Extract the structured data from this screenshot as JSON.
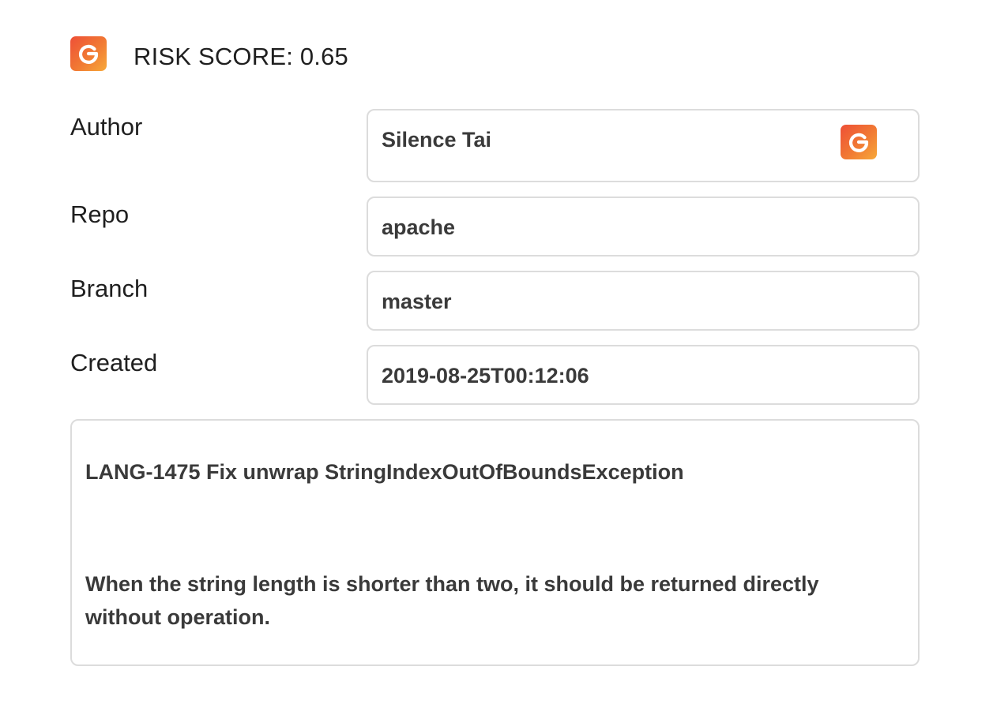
{
  "header": {
    "logo_icon": "g-logo-icon",
    "risk_score_text": "RISK SCORE: 0.65"
  },
  "fields": {
    "author": {
      "label": "Author",
      "value": "Silence Tai",
      "icon": "g-logo-icon"
    },
    "repo": {
      "label": "Repo",
      "value": "apache"
    },
    "branch": {
      "label": "Branch",
      "value": "master"
    },
    "created": {
      "label": "Created",
      "value": "2019-08-25T00:12:06"
    }
  },
  "message": {
    "title": "LANG-1475 Fix unwrap StringIndexOutOfBoundsException",
    "body": "When the string length is shorter than two, it should be returned directly without operation."
  },
  "colors": {
    "logo_gradient_start": "#ee4f36",
    "logo_gradient_end": "#f7a93a",
    "border": "#dcdcdc",
    "value_text": "#3a3a3a"
  }
}
